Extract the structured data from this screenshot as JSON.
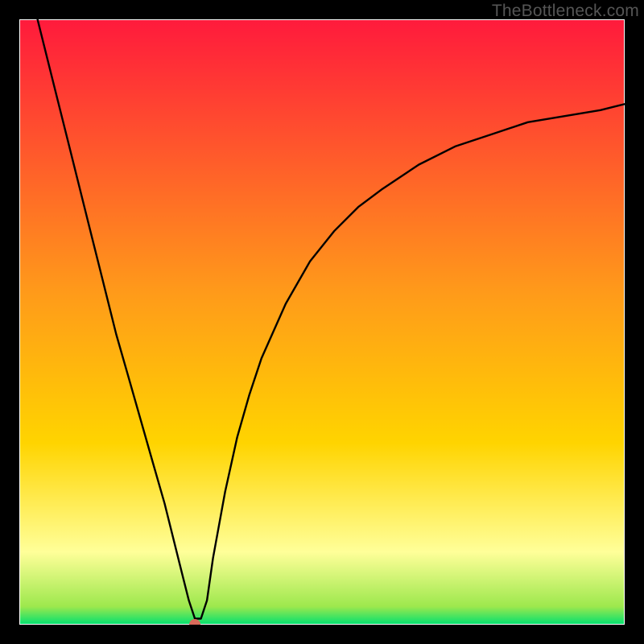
{
  "watermark": "TheBottleneck.com",
  "colors": {
    "top": "#ff1a3c",
    "mid": "#ffd400",
    "low": "#ffff99",
    "bottom": "#00e070",
    "curve": "#000000",
    "dot": "#d96a5a",
    "frame": "#000000",
    "border": "#ffffff"
  },
  "chart_data": {
    "type": "line",
    "title": "",
    "xlabel": "",
    "ylabel": "",
    "xlim": [
      0,
      100
    ],
    "ylim": [
      0,
      100
    ],
    "notch": {
      "x": 29,
      "y": 0
    },
    "series": [
      {
        "name": "bottleneck-curve",
        "x": [
          3,
          4,
          5,
          6,
          8,
          10,
          12,
          14,
          16,
          18,
          20,
          22,
          24,
          25,
          26,
          27,
          28,
          29,
          30,
          31,
          32,
          34,
          36,
          38,
          40,
          44,
          48,
          52,
          56,
          60,
          66,
          72,
          78,
          84,
          90,
          96,
          100
        ],
        "y": [
          100,
          96,
          92,
          88,
          80,
          72,
          64,
          56,
          48,
          41,
          34,
          27,
          20,
          16,
          12,
          8,
          4,
          1,
          1,
          4,
          11,
          22,
          31,
          38,
          44,
          53,
          60,
          65,
          69,
          72,
          76,
          79,
          81,
          83,
          84,
          85,
          86
        ]
      }
    ],
    "annotations": [
      {
        "type": "dot",
        "x": 29,
        "y": 0,
        "color": "#d96a5a"
      }
    ]
  }
}
